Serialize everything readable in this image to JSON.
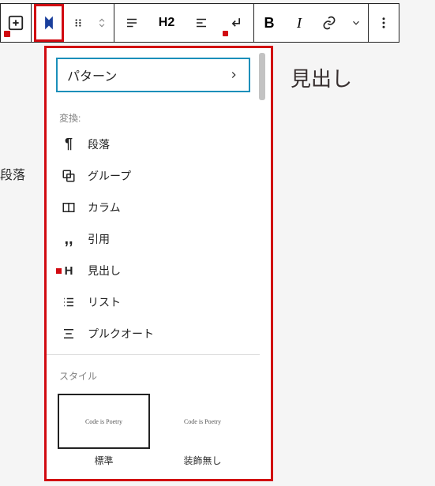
{
  "toolbar": {
    "heading_level": "H2"
  },
  "sidebar_partial": "段落",
  "canvas_heading": "見出し",
  "panel": {
    "pattern_label": "パターン",
    "transform_label": "変換:",
    "items": [
      {
        "label": "段落"
      },
      {
        "label": "グループ"
      },
      {
        "label": "カラム"
      },
      {
        "label": "引用"
      },
      {
        "label": "見出し"
      },
      {
        "label": "リスト"
      },
      {
        "label": "プルクオート"
      }
    ],
    "style_label": "スタイル",
    "style_preview_text": "Code is Poetry",
    "styles": [
      {
        "label": "標準"
      },
      {
        "label": "装飾無し"
      }
    ]
  }
}
